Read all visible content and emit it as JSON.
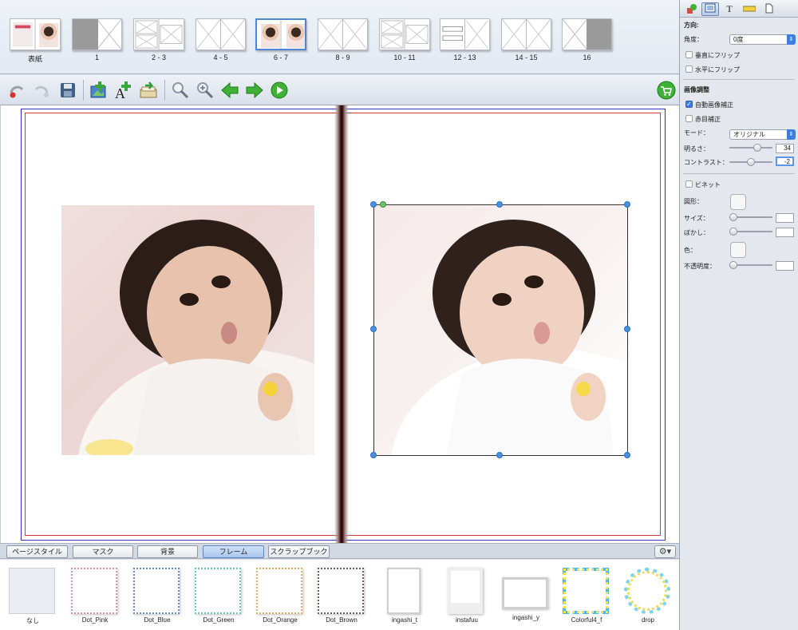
{
  "thumbnails": [
    {
      "label": "表紙",
      "kind": "cover",
      "selected": false
    },
    {
      "label": "1",
      "kind": "gray-left",
      "selected": false
    },
    {
      "label": "2 - 3",
      "kind": "grid",
      "selected": false
    },
    {
      "label": "4 - 5",
      "kind": "x",
      "selected": false
    },
    {
      "label": "6 - 7",
      "kind": "photos",
      "selected": true
    },
    {
      "label": "8 - 9",
      "kind": "x",
      "selected": false
    },
    {
      "label": "10 - 11",
      "kind": "grid",
      "selected": false
    },
    {
      "label": "12 - 13",
      "kind": "bars",
      "selected": false
    },
    {
      "label": "14 - 15",
      "kind": "x",
      "selected": false
    },
    {
      "label": "16",
      "kind": "gray-right",
      "selected": false
    }
  ],
  "toolbar": {
    "icons": [
      "undo-icon",
      "redo-icon",
      "save-icon",
      "add-photo-icon",
      "add-text-icon",
      "add-page-icon",
      "zoom-out-icon",
      "zoom-in-icon",
      "prev-page-icon",
      "next-page-icon",
      "play-icon",
      "cart-icon"
    ]
  },
  "bottom_tabs": [
    {
      "label": "ページスタイル",
      "active": false
    },
    {
      "label": "マスク",
      "active": false
    },
    {
      "label": "背景",
      "active": false
    },
    {
      "label": "フレーム",
      "active": true
    },
    {
      "label": "スクラップブック",
      "active": false
    }
  ],
  "gear_label": "⚙▾",
  "frames": [
    {
      "label": "なし",
      "style": "none"
    },
    {
      "label": "Dot_Pink",
      "style": "dot",
      "color": "#e88aa7"
    },
    {
      "label": "Dot_Blue",
      "style": "dot",
      "color": "#6b86c9"
    },
    {
      "label": "Dot_Green",
      "style": "dot",
      "color": "#6cc6b4"
    },
    {
      "label": "Dot_Orange",
      "style": "dot",
      "color": "#f0a860"
    },
    {
      "label": "Dot_Brown",
      "style": "dot",
      "color": "#6a5a52"
    },
    {
      "label": "ingashi_t",
      "style": "plain",
      "color": "#cfcfcf"
    },
    {
      "label": "instafuu",
      "style": "insta",
      "color": "#d5d5d5"
    },
    {
      "label": "ingashi_y",
      "style": "wide",
      "color": "#cfcfcf"
    },
    {
      "label": "Colorful4_f",
      "style": "colorful",
      "color": "#f3e34b"
    },
    {
      "label": "drop",
      "style": "drop",
      "color": "#7fd3ef"
    }
  ],
  "inspector": {
    "direction_heading": "方向:",
    "angle_label": "角度：",
    "angle_value": "0度",
    "flip_vertical": "垂直にフリップ",
    "flip_horizontal": "水平にフリップ",
    "image_adjust_heading": "画像調整",
    "auto_correct": "自動画像補正",
    "auto_correct_checked": true,
    "red_eye": "赤目補正",
    "mode_label": "モード：",
    "mode_value": "オリジナル",
    "brightness_label": "明るさ：",
    "brightness_value": "34",
    "contrast_label": "コントラスト：",
    "contrast_value": "-2",
    "vignette": "ビネット",
    "shape_label": "図形：",
    "size_label": "サイズ：",
    "blur_label": "ぼかし：",
    "color_label": "色：",
    "opacity_label": "不透明度："
  }
}
